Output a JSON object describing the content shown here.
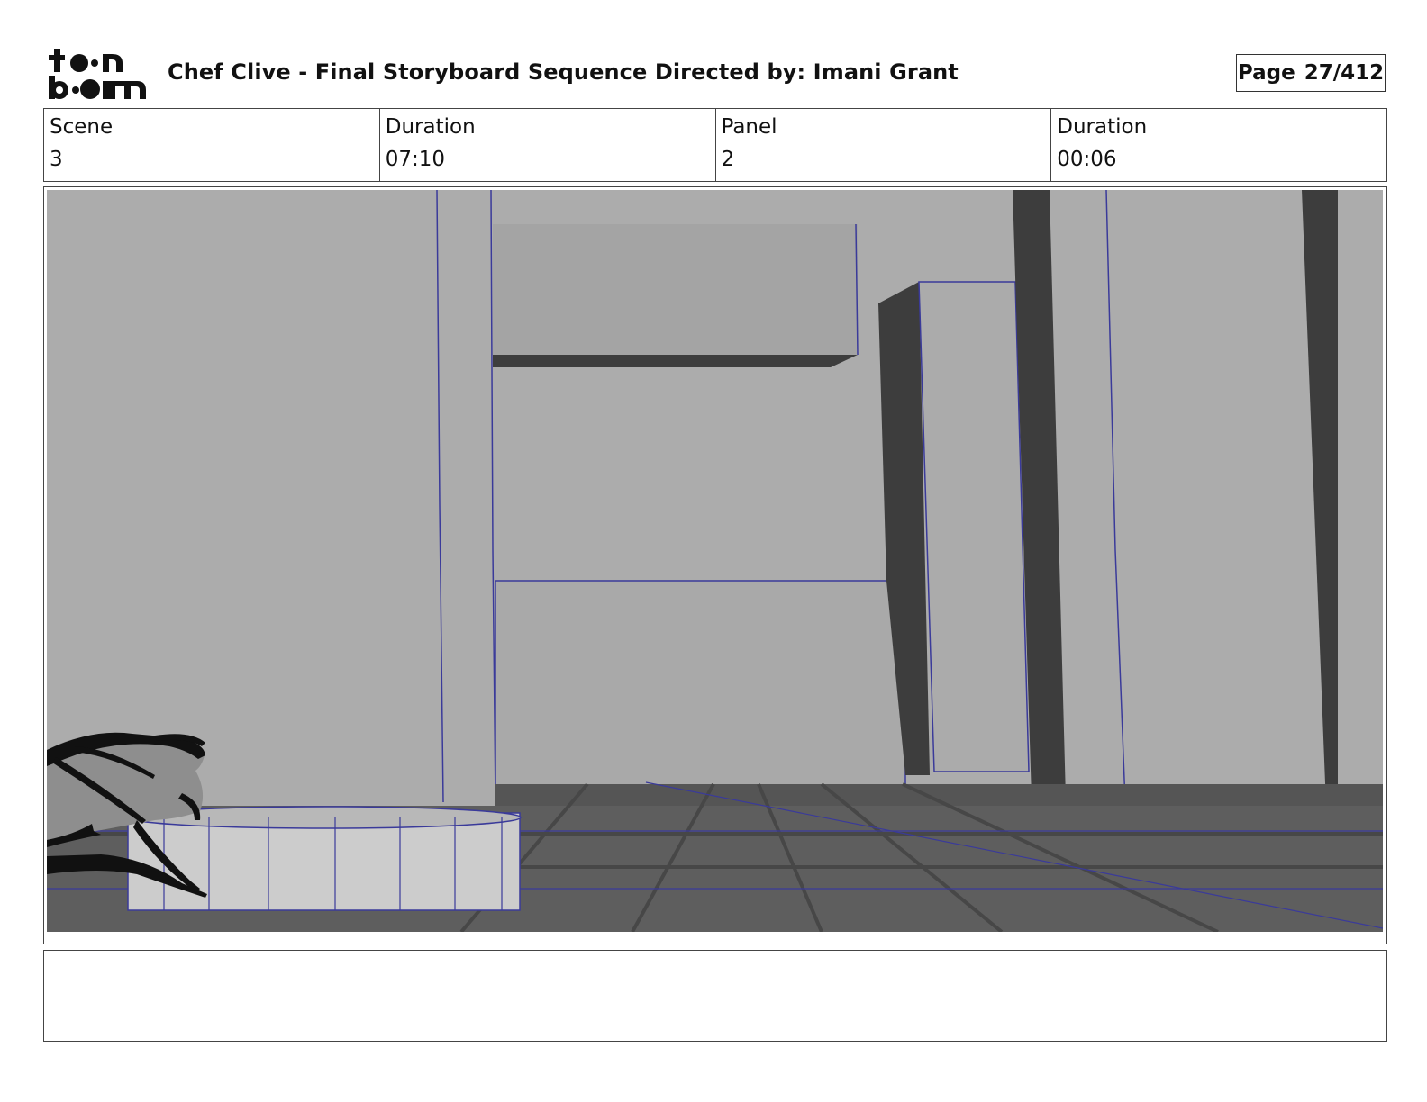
{
  "header": {
    "logo_text": "toon boom",
    "title": "Chef Clive - Final Storyboard Sequence  Directed by: Imani Grant",
    "page_label": "Page",
    "page_value": "27/412"
  },
  "info": {
    "scene_label": "Scene",
    "scene_value": "3",
    "scene_duration_label": "Duration",
    "scene_duration_value": "07:10",
    "panel_label": "Panel",
    "panel_value": "2",
    "panel_duration_label": "Duration",
    "panel_duration_value": "00:06"
  },
  "panel": {
    "colors": {
      "wall": "#acacac",
      "shadow": "#3d3d3d",
      "floor": "#5e5e5e",
      "wireframe": "#3a3a9a",
      "sketch": "#111111"
    }
  },
  "notes": {
    "text": ""
  }
}
